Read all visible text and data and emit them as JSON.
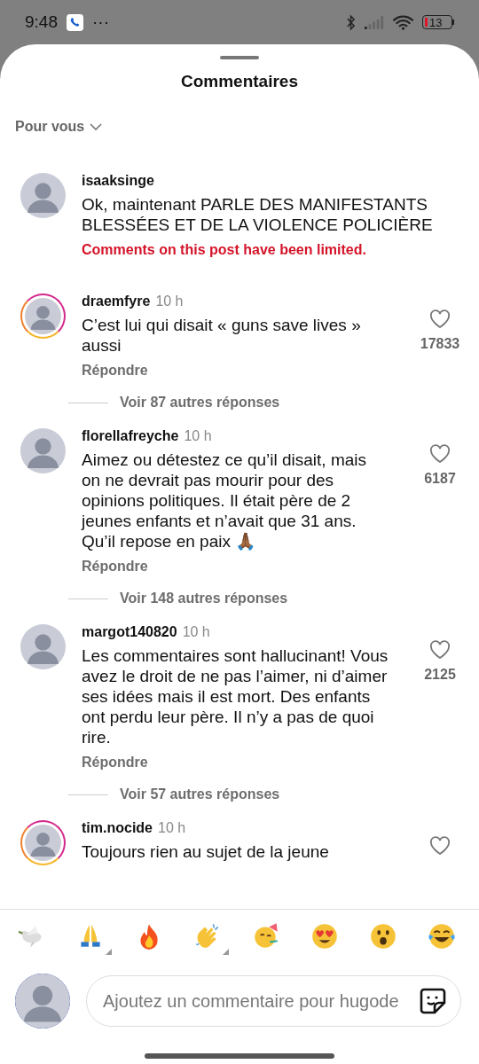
{
  "status_bar": {
    "time": "9:48",
    "notification_dots": "···",
    "battery": "13",
    "battery_low": true
  },
  "sheet": {
    "title": "Commentaires",
    "filter": "Pour vous"
  },
  "comments": [
    {
      "user": "isaaksinge",
      "text": "Ok, maintenant PARLE DES MANIFESTANTS BLESSÉES ET DE LA VIOLENCE POLICIÈRE",
      "notice": "Comments on this post have been limited.",
      "story_ring": false,
      "like_button": false
    },
    {
      "user": "draemfyre",
      "time": "10 h",
      "text": "C’est lui qui disait « guns save lives » aussi",
      "reply": "Répondre",
      "likes": "17833",
      "more_replies": "Voir 87 autres réponses",
      "story_ring": true,
      "like_button": true
    },
    {
      "user": "florellafreyche",
      "time": "10 h",
      "text": "Aimez ou détestez ce qu’il disait, mais on ne devrait pas mourir pour des opinions politiques. Il était père de 2 jeunes enfants et n’avait que 31 ans. Qu’il repose en paix 🙏🏾",
      "reply": "Répondre",
      "likes": "6187",
      "more_replies": "Voir 148 autres réponses",
      "story_ring": false,
      "like_button": true
    },
    {
      "user": "margot140820",
      "time": "10 h",
      "text": "Les commentaires sont hallucinant! Vous avez le droit de ne pas l’aimer, ni d’aimer ses idées mais il est mort. Des enfants ont perdu leur père. Il n’y a pas de quoi rire.",
      "reply": "Répondre",
      "likes": "2125",
      "more_replies": "Voir 57 autres réponses",
      "story_ring": false,
      "like_button": true
    },
    {
      "user": "tim.nocide",
      "time": "10 h",
      "text": "Toujours rien au sujet de la jeune",
      "story_ring": true,
      "like_button": true
    }
  ],
  "reactions": [
    {
      "kind": "dove",
      "has_variants": false
    },
    {
      "kind": "pray",
      "has_variants": true
    },
    {
      "kind": "fire",
      "has_variants": false
    },
    {
      "kind": "clap",
      "has_variants": true
    },
    {
      "kind": "party",
      "has_variants": false
    },
    {
      "kind": "hearteyes",
      "has_variants": false
    },
    {
      "kind": "surprised",
      "has_variants": false
    },
    {
      "kind": "laugh",
      "has_variants": false
    }
  ],
  "composer": {
    "placeholder": "Ajoutez un commentaire pour hugode"
  }
}
